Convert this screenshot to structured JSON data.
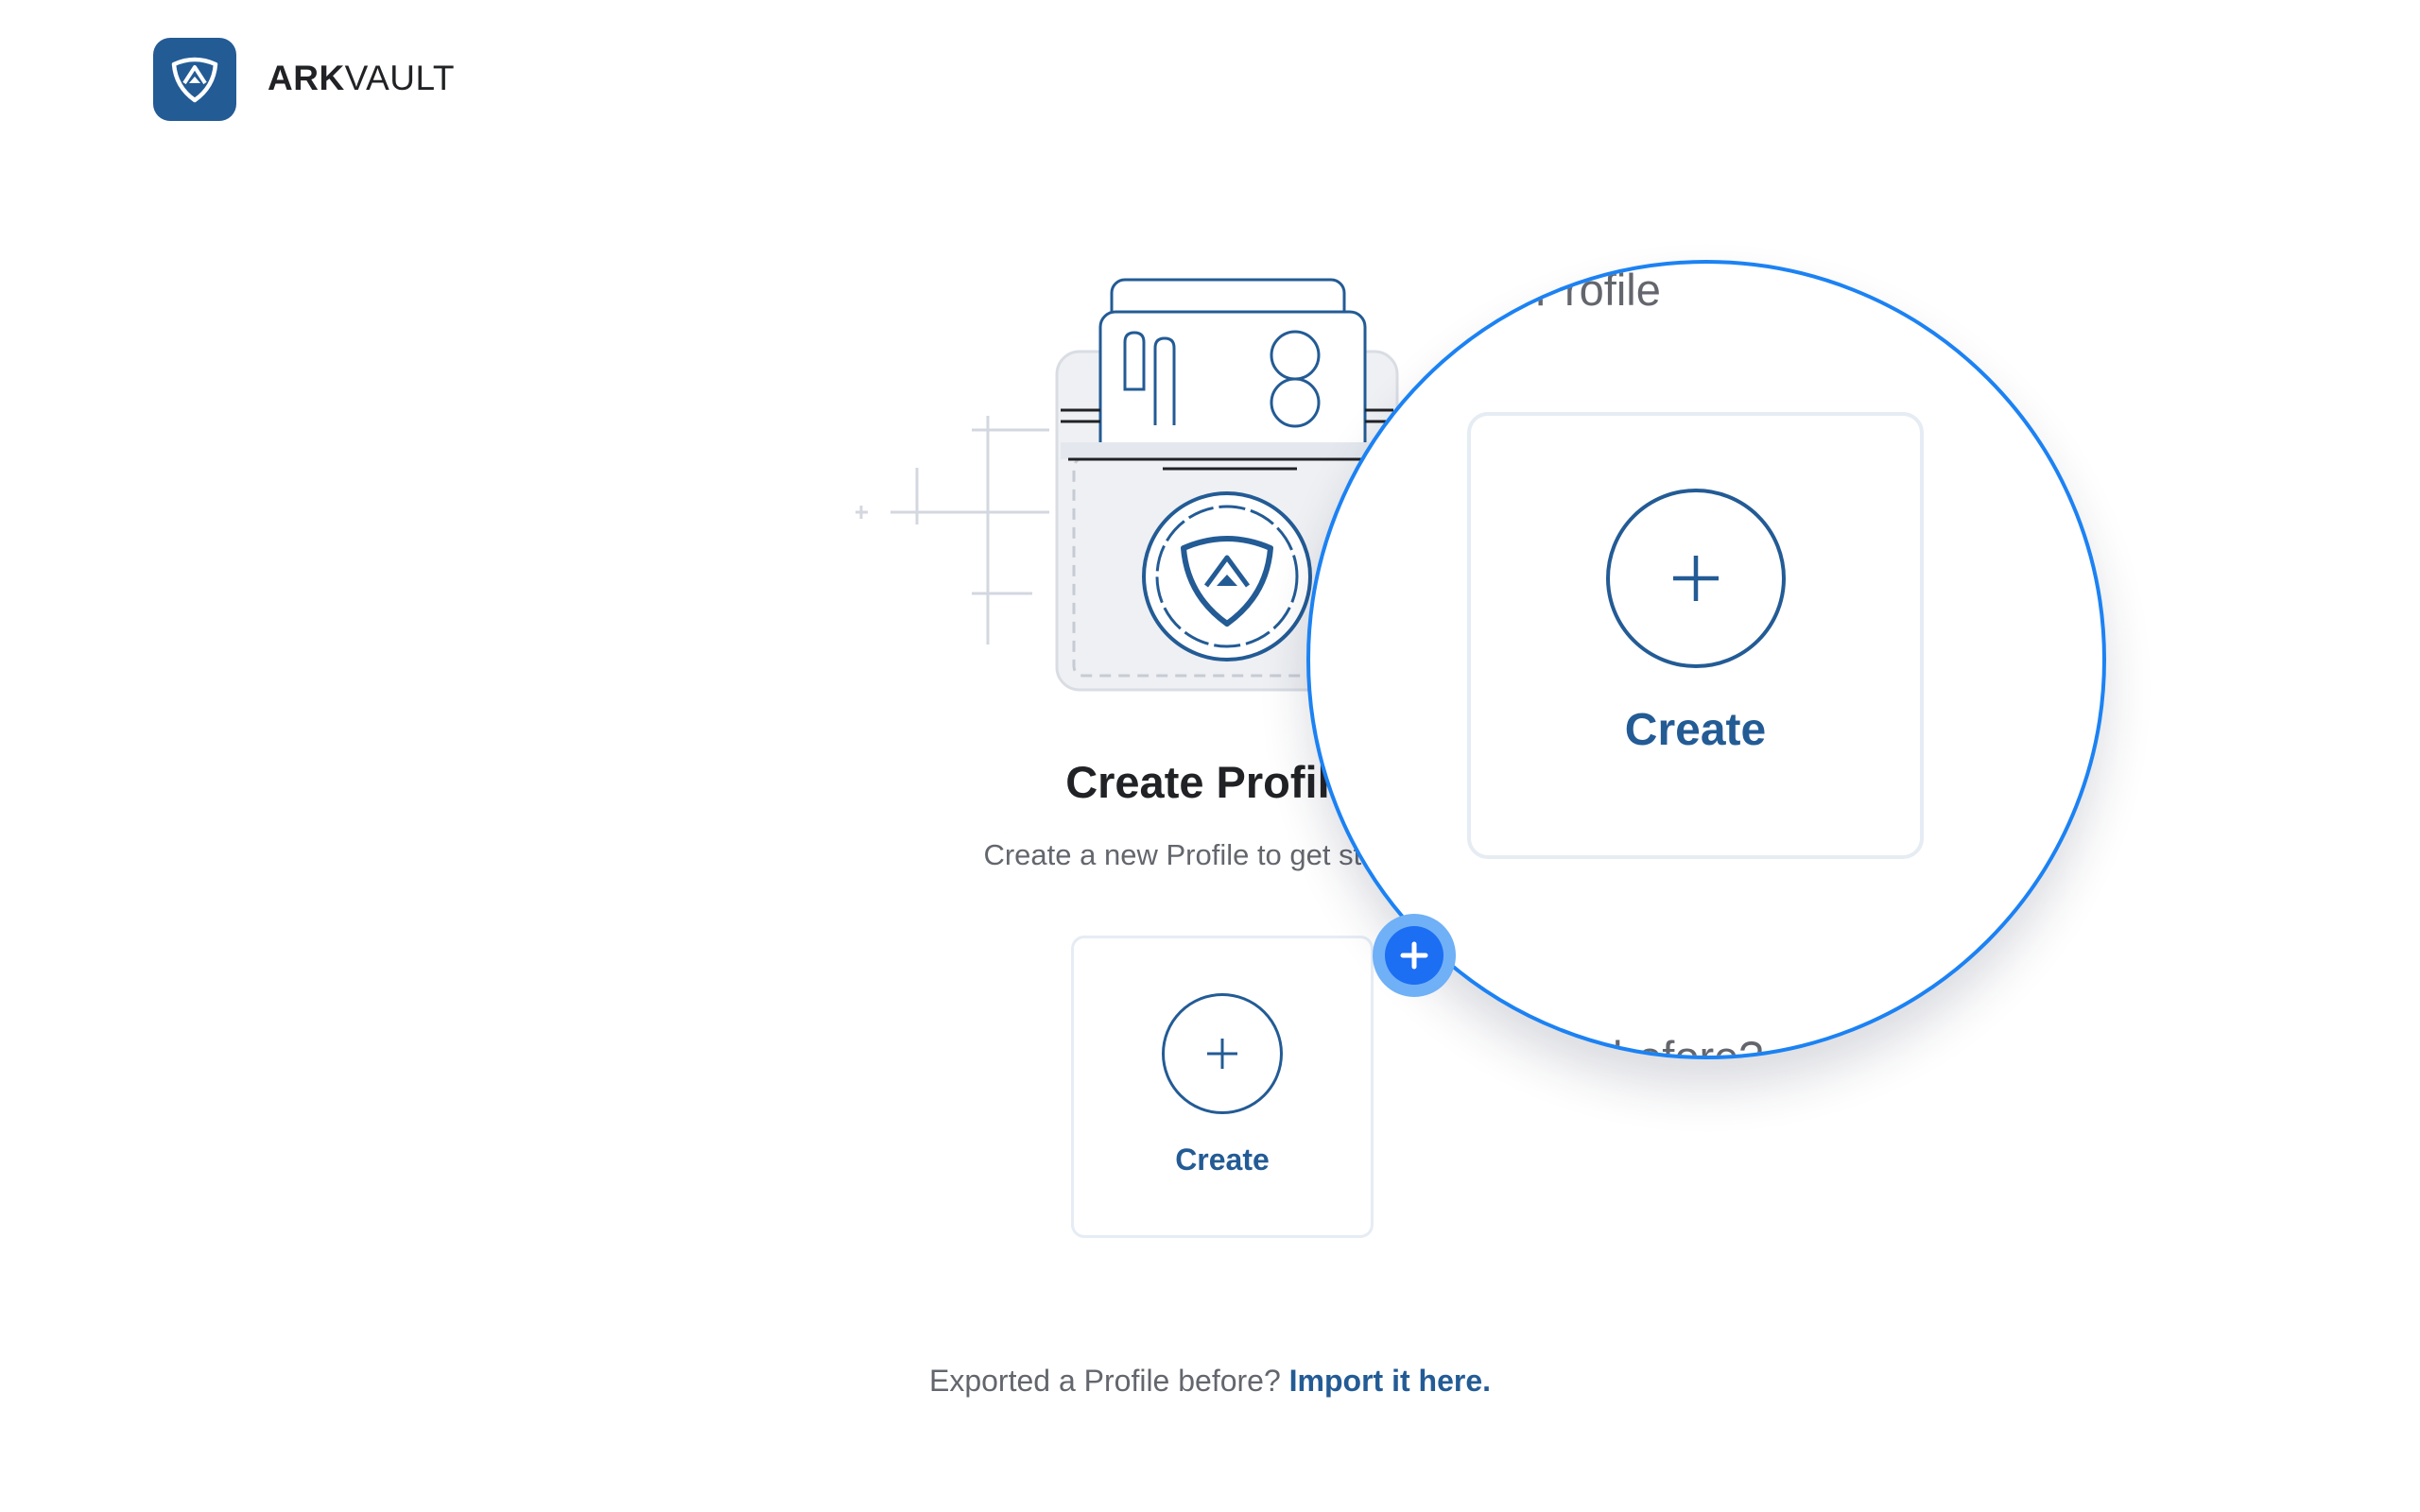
{
  "header": {
    "brand_bold": "ARK",
    "brand_light": "VAULT",
    "logo_icon": "ark-shield-icon"
  },
  "main": {
    "title": "Create Profile",
    "subtitle": "Create a new Profile to get started.",
    "create_card": {
      "label": "Create",
      "icon": "plus-icon"
    },
    "illustration_icon": "wallet-illustration"
  },
  "footer": {
    "text": "Exported a Profile before?",
    "link_label": "Import it here."
  },
  "magnifier": {
    "subtitle_fragment": "e a new  Profile",
    "footer_fragment": "before?",
    "create_label": "Create",
    "handle_icon": "plus-icon"
  },
  "colors": {
    "brand": "#235b95",
    "magnifier_ring": "#1c82f3",
    "handle": "#1c6ef2",
    "card_border": "#e6ecf4"
  }
}
